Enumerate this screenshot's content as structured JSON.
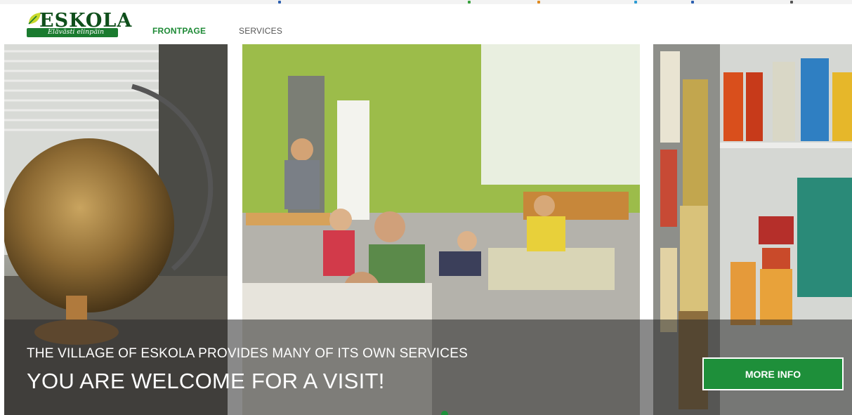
{
  "header": {
    "logo": {
      "name": "ESKOLA",
      "tagline": "Elävästi elinpäin"
    },
    "nav": [
      {
        "label": "FRONTPAGE",
        "active": true
      },
      {
        "label": "SERVICES",
        "active": false
      }
    ]
  },
  "hero": {
    "subtitle": "THE VILLAGE OF ESKOLA PROVIDES MANY OF ITS OWN SERVICES",
    "headline": "YOU ARE WELCOME FOR A VISIT!",
    "button_label": "MORE INFO",
    "images": [
      "globe-photo",
      "daycare-photo",
      "shop-photo"
    ]
  },
  "colors": {
    "brand_green": "#1e8f3a",
    "nav_active": "#1e8a36",
    "nav_inactive": "#555555",
    "overlay": "rgba(40,40,40,0.55)"
  }
}
